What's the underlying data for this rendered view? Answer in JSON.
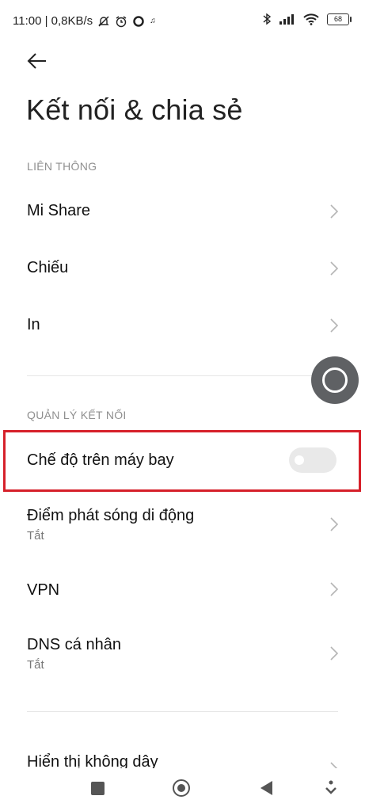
{
  "status_bar": {
    "time_speed": "11:00 | 0,8KB/s",
    "battery": "68",
    "icons": [
      "mute-bell-icon",
      "alarm-icon",
      "circle-icon",
      "music-note-icon",
      "bluetooth-icon",
      "signal-icon",
      "wifi-icon",
      "battery-icon"
    ]
  },
  "header": {
    "title": "Kết nối & chia sẻ"
  },
  "sections": {
    "connectivity": {
      "header": "LIÊN THÔNG",
      "items": [
        {
          "label": "Mi Share"
        },
        {
          "label": "Chiếu"
        },
        {
          "label": "In"
        }
      ]
    },
    "connection_management": {
      "header": "QUẢN LÝ KẾT NỐI",
      "airplane_mode": {
        "label": "Chế độ trên máy bay",
        "enabled": false
      },
      "items": [
        {
          "label": "Điểm phát sóng di động",
          "subtitle": "Tắt"
        },
        {
          "label": "VPN"
        },
        {
          "label": "DNS cá nhân",
          "subtitle": "Tắt"
        }
      ]
    },
    "partial": {
      "label": "Hiển thị không dây"
    }
  },
  "colors": {
    "highlight": "#d6202a",
    "toggle_off": "#e9e9e9",
    "floating_button": "#5f6164"
  }
}
